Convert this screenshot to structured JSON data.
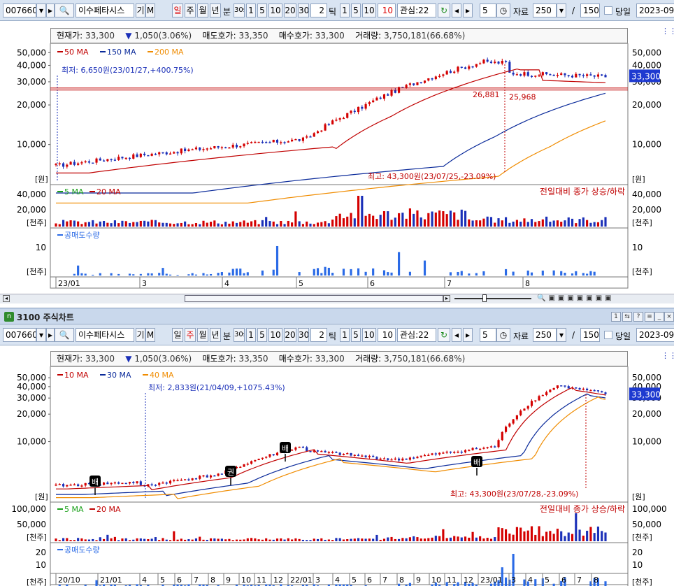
{
  "top": {
    "toolbar": {
      "code": "007660",
      "name": "이수페타시스",
      "g_label": "기",
      "m_label": "M",
      "period_day": "일",
      "period_week": "주",
      "period_month": "월",
      "period_year": "년",
      "min_label": "분",
      "m30": "30s",
      "n1": "1",
      "n5": "5",
      "n10": "10",
      "n20": "20",
      "n30": "30",
      "tick_val": "2",
      "tick_label": "틱",
      "t1": "1",
      "t5": "5",
      "t10": "10",
      "t_input": "10",
      "interest": "관심:22",
      "num5": "5",
      "data_label": "자료",
      "data_val": "250",
      "slash": "/",
      "data_total": "150",
      "today_label": "당일",
      "date": "2023-09-0"
    },
    "info": {
      "cur_label": "현재가:",
      "cur_val": "33,300",
      "change": "1,050(3.06%)",
      "ask_label": "매도호가:",
      "ask_val": "33,350",
      "bid_label": "매수호가:",
      "bid_val": "33,300",
      "vol_label": "거래량:",
      "vol_val": "3,750,181(66.68%)"
    },
    "ma_legend": [
      "50 MA",
      "150 MA",
      "200 MA"
    ],
    "price_axis": [
      "50,000",
      "40,000",
      "30,000",
      "20,000",
      "10,000",
      "[원]"
    ],
    "last_price": "33,300",
    "low_note": "최저: 6,650원(23/01/27,+400.75%)",
    "high_note": "최고: 43,300원(23/07/25,-23.09%)",
    "level1": "26,881",
    "level2": "25,968",
    "vol_legend": [
      "5 MA",
      "20 MA"
    ],
    "vol_note": "전일대비 종가 상승/하락",
    "vol_axis": [
      "40,000",
      "20,000",
      "[천주]"
    ],
    "short_legend": "공매도수량",
    "short_axis": [
      "10",
      "[천주]"
    ],
    "x_labels": [
      "23/01",
      "3",
      "4",
      "5",
      "6",
      "7",
      "8"
    ]
  },
  "bottom": {
    "title": "3100 주식차트",
    "toolbar": {
      "code": "007660",
      "name": "이수페타시스",
      "g_label": "기",
      "m_label": "M",
      "period_day": "일",
      "period_week": "주",
      "period_month": "월",
      "period_year": "년",
      "min_label": "분",
      "m30": "30s",
      "n1": "1",
      "n5": "5",
      "n10": "10",
      "n20": "20",
      "n30": "30",
      "tick_val": "2",
      "tick_label": "틱",
      "t1": "1",
      "t5": "5",
      "t10": "10",
      "t_input": "10",
      "interest": "관심:22",
      "num5": "5",
      "data_label": "자료",
      "data_val": "250",
      "slash": "/",
      "data_total": "150",
      "today_label": "당일",
      "date": "2023-09-0"
    },
    "info": {
      "cur_label": "현재가:",
      "cur_val": "33,300",
      "change": "1,050(3.06%)",
      "ask_label": "매도호가:",
      "ask_val": "33,350",
      "bid_label": "매수호가:",
      "bid_val": "33,300",
      "vol_label": "거래량:",
      "vol_val": "3,750,181(66.68%)"
    },
    "ma_legend": [
      "10 MA",
      "30 MA",
      "40 MA"
    ],
    "price_axis": [
      "50,000",
      "40,000",
      "30,000",
      "20,000",
      "10,000",
      "[원]"
    ],
    "last_price": "33,300",
    "low_note": "최저: 2,833원(21/04/09,+1075.43%)",
    "high_note": "최고: 43,300원(23/07/28,-23.09%)",
    "markers": [
      "배",
      "권",
      "배",
      "배"
    ],
    "vol_legend": [
      "5 MA",
      "20 MA"
    ],
    "vol_note": "전일대비 종가 상승/하락",
    "vol_axis": [
      "100,000",
      "50,000",
      "[천주]"
    ],
    "short_legend": "공매도수량",
    "short_axis": [
      "20",
      "10",
      "[천주]"
    ],
    "x_labels": [
      "20/10",
      "21/01",
      "4",
      "5",
      "6",
      "7",
      "8",
      "9",
      "10",
      "11",
      "12",
      "22/01",
      "3",
      "4",
      "5",
      "6",
      "7",
      "8",
      "9",
      "10",
      "11",
      "12",
      "23/01",
      "3",
      "4",
      "5",
      "6",
      "7",
      "8"
    ]
  },
  "colors": {
    "up": "#d40000",
    "down": "#1a2fb8",
    "ma_red": "#c00000",
    "ma_blue": "#0a2a9a",
    "ma_orange": "#f08c00",
    "ma_green": "#1aa01a",
    "short": "#2a6ae6",
    "price_tag": "#1e3ad0"
  }
}
